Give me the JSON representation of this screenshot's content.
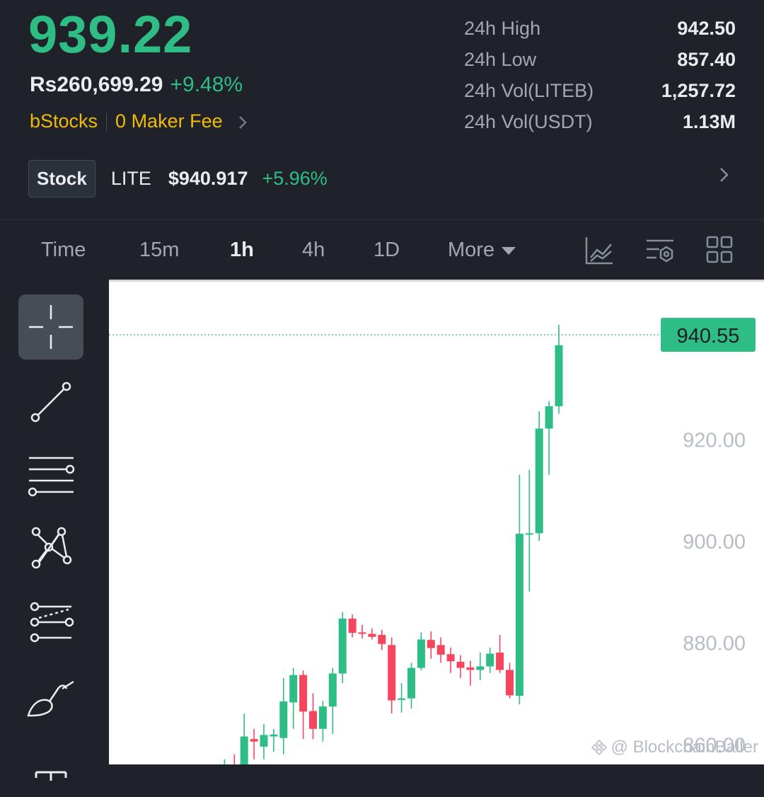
{
  "ticker": {
    "last_price": "939.22",
    "fiat_price": "Rs260,699.29",
    "change_pct": "+9.48%",
    "promo_brand": "bStocks",
    "promo_text": "0 Maker Fee"
  },
  "stats": [
    {
      "label": "24h High",
      "value": "942.50"
    },
    {
      "label": "24h Low",
      "value": "857.40"
    },
    {
      "label": "24h Vol(LITEB)",
      "value": "1,257.72"
    },
    {
      "label": "24h Vol(USDT)",
      "value": "1.13M"
    }
  ],
  "stock": {
    "badge": "Stock",
    "symbol": "LITE",
    "price": "$940.917",
    "change": "+5.96%"
  },
  "tabs": {
    "time": "Time",
    "m15": "15m",
    "h1": "1h",
    "h4": "4h",
    "d1": "1D",
    "more": "More",
    "active": "1h"
  },
  "icons": {
    "sidebar": [
      "crosshair-icon",
      "trend-line-icon",
      "horizontal-lines-icon",
      "pattern-icon",
      "fib-lines-icon",
      "brush-icon",
      "text-icon"
    ],
    "toolbar": [
      "chart-indicator-icon",
      "settings-sliders-icon",
      "grid-layout-icon"
    ]
  },
  "colors": {
    "up": "#2ebd85",
    "down": "#f6465d",
    "promo": "#f0b90b",
    "background": "#1f2329"
  },
  "chart_data": {
    "type": "candlestick",
    "interval": "1h",
    "ylim": [
      856,
      951
    ],
    "yticks": [
      "920.00",
      "900.00",
      "880.00",
      "860.00"
    ],
    "current_price_label": "940.55",
    "current_price": 940.55,
    "candles": [
      {
        "o": 855.0,
        "h": 857.0,
        "l": 852.0,
        "c": 855.8
      },
      {
        "o": 855.5,
        "h": 858.0,
        "l": 852.0,
        "c": 855.0
      },
      {
        "o": 855.0,
        "h": 866.0,
        "l": 853.0,
        "c": 861.5
      },
      {
        "o": 861.0,
        "h": 863.0,
        "l": 857.0,
        "c": 860.5
      },
      {
        "o": 859.5,
        "h": 864.0,
        "l": 857.0,
        "c": 861.8
      },
      {
        "o": 861.5,
        "h": 863.0,
        "l": 858.5,
        "c": 861.9
      },
      {
        "o": 861.2,
        "h": 873.0,
        "l": 858.0,
        "c": 868.4
      },
      {
        "o": 868.2,
        "h": 875.0,
        "l": 863.0,
        "c": 873.6
      },
      {
        "o": 873.6,
        "h": 874.5,
        "l": 861.0,
        "c": 866.4
      },
      {
        "o": 866.5,
        "h": 870.0,
        "l": 861.0,
        "c": 863.0
      },
      {
        "o": 863.0,
        "h": 868.5,
        "l": 860.5,
        "c": 867.4
      },
      {
        "o": 867.4,
        "h": 875.0,
        "l": 862.0,
        "c": 873.9
      },
      {
        "o": 873.9,
        "h": 886.0,
        "l": 872.0,
        "c": 884.7
      },
      {
        "o": 884.7,
        "h": 885.5,
        "l": 881.0,
        "c": 881.9
      },
      {
        "o": 882.0,
        "h": 883.5,
        "l": 880.8,
        "c": 881.7
      },
      {
        "o": 881.7,
        "h": 882.8,
        "l": 880.6,
        "c": 881.1
      },
      {
        "o": 881.5,
        "h": 882.5,
        "l": 878.5,
        "c": 879.7
      },
      {
        "o": 879.5,
        "h": 881.0,
        "l": 866.0,
        "c": 868.6
      },
      {
        "o": 868.7,
        "h": 872.0,
        "l": 866.2,
        "c": 869.0
      },
      {
        "o": 869.0,
        "h": 876.0,
        "l": 867.0,
        "c": 875.0
      },
      {
        "o": 875.0,
        "h": 882.0,
        "l": 874.5,
        "c": 880.6
      },
      {
        "o": 880.5,
        "h": 882.2,
        "l": 876.8,
        "c": 878.9
      },
      {
        "o": 879.5,
        "h": 881.0,
        "l": 876.0,
        "c": 877.6
      },
      {
        "o": 877.7,
        "h": 879.0,
        "l": 874.0,
        "c": 876.3
      },
      {
        "o": 876.2,
        "h": 877.5,
        "l": 873.0,
        "c": 875.0
      },
      {
        "o": 875.1,
        "h": 876.4,
        "l": 871.5,
        "c": 874.6
      },
      {
        "o": 874.6,
        "h": 878.0,
        "l": 872.6,
        "c": 875.3
      },
      {
        "o": 875.3,
        "h": 879.0,
        "l": 874.0,
        "c": 877.8
      },
      {
        "o": 878.0,
        "h": 881.5,
        "l": 874.0,
        "c": 874.6
      },
      {
        "o": 874.6,
        "h": 876.0,
        "l": 869.0,
        "c": 869.6
      },
      {
        "o": 869.5,
        "h": 913.0,
        "l": 867.8,
        "c": 901.4
      },
      {
        "o": 901.4,
        "h": 914.0,
        "l": 890.0,
        "c": 901.5
      },
      {
        "o": 901.5,
        "h": 925.5,
        "l": 900.0,
        "c": 922.1
      },
      {
        "o": 922.1,
        "h": 927.5,
        "l": 913.0,
        "c": 926.5
      },
      {
        "o": 926.5,
        "h": 942.5,
        "l": 925.0,
        "c": 938.5
      }
    ]
  },
  "watermark": "@ BlockchainBaller"
}
